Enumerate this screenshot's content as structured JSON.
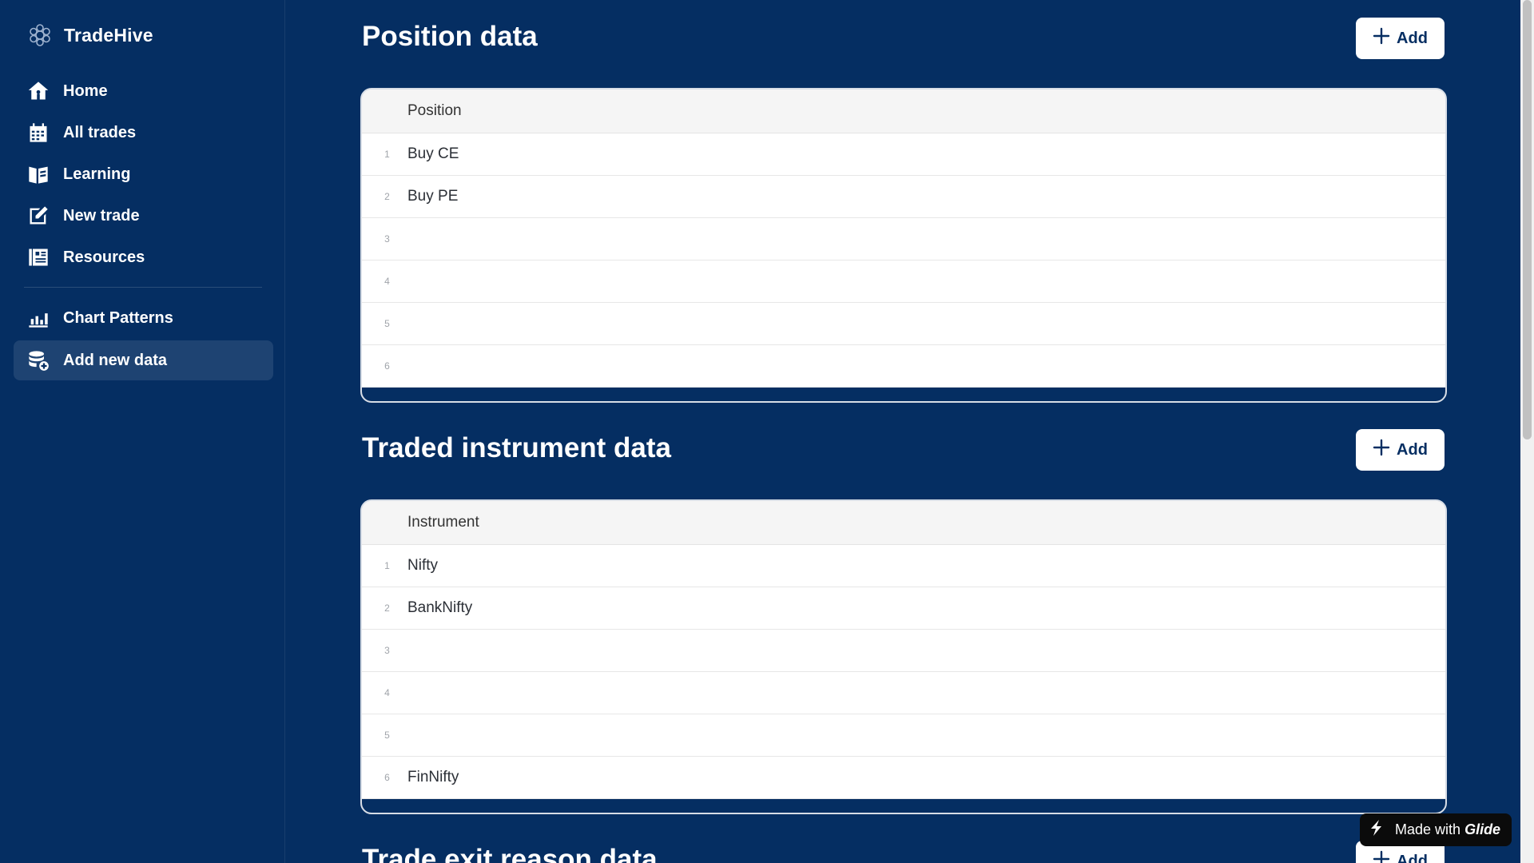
{
  "app": {
    "name": "TradeHive"
  },
  "sidebar": {
    "items": [
      {
        "label": "Home",
        "icon": "home-icon"
      },
      {
        "label": "All trades",
        "icon": "calendar-icon"
      },
      {
        "label": "Learning",
        "icon": "book-icon"
      },
      {
        "label": "New trade",
        "icon": "edit-icon"
      },
      {
        "label": "Resources",
        "icon": "newspaper-icon"
      },
      {
        "label": "Chart Patterns",
        "icon": "bar-chart-icon"
      },
      {
        "label": "Add new data",
        "icon": "database-add-icon",
        "active": true
      }
    ]
  },
  "sections": [
    {
      "title": "Position data",
      "add_label": "Add",
      "column": "Position",
      "rows": [
        {
          "num": "1",
          "value": "Buy CE"
        },
        {
          "num": "2",
          "value": "Buy PE"
        },
        {
          "num": "3",
          "value": ""
        },
        {
          "num": "4",
          "value": ""
        },
        {
          "num": "5",
          "value": ""
        },
        {
          "num": "6",
          "value": ""
        }
      ]
    },
    {
      "title": "Traded instrument data",
      "add_label": "Add",
      "column": "Instrument",
      "rows": [
        {
          "num": "1",
          "value": "Nifty"
        },
        {
          "num": "2",
          "value": "BankNifty"
        },
        {
          "num": "3",
          "value": ""
        },
        {
          "num": "4",
          "value": ""
        },
        {
          "num": "5",
          "value": ""
        },
        {
          "num": "6",
          "value": "FinNifty"
        }
      ]
    },
    {
      "title": "Trade exit reason data",
      "add_label": "Add"
    }
  ],
  "badge": {
    "prefix": "Made with",
    "brand": "Glide"
  },
  "colors": {
    "background": "#052e62",
    "button_text": "#052e62"
  }
}
